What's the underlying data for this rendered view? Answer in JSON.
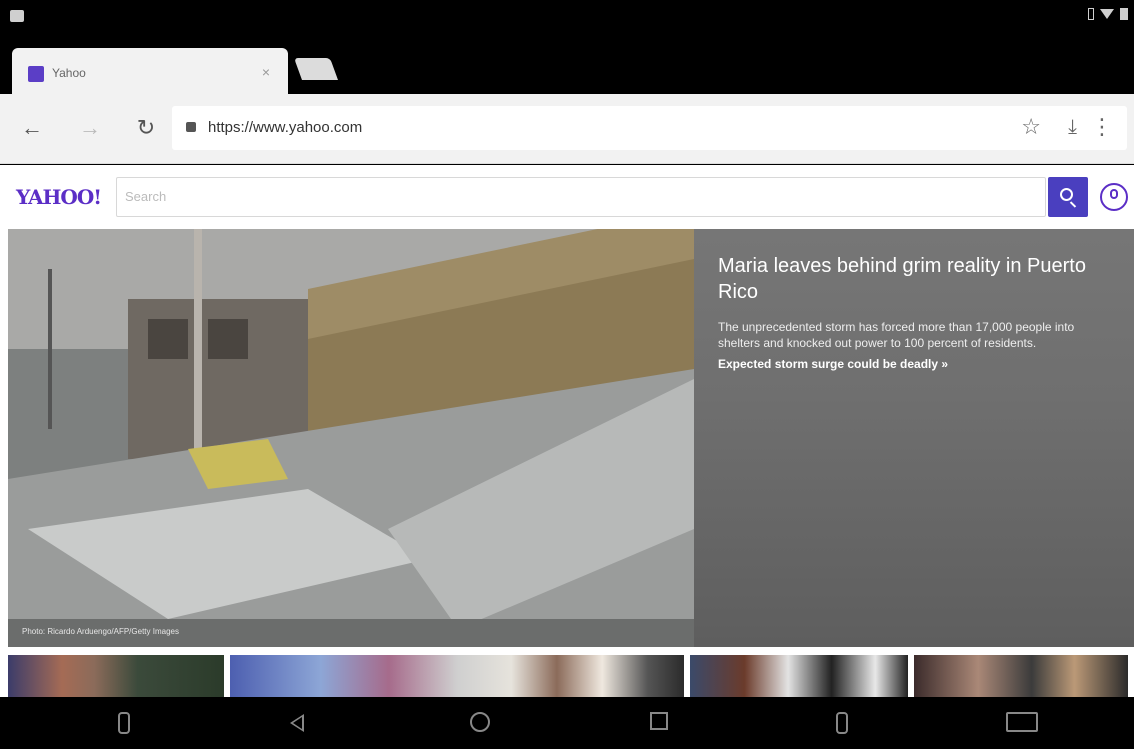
{
  "browser": {
    "tab_title": "Yahoo",
    "tab_close": "×",
    "url": "https://www.yahoo.com",
    "back_icon": "back-arrow-icon",
    "forward_icon": "forward-arrow-icon",
    "reload_icon": "reload-icon",
    "star_icon": "star-icon",
    "download_icon": "download-icon",
    "menu_icon": "overflow-menu-icon"
  },
  "yahoo": {
    "logo": "YAHOO!",
    "search_placeholder": "Search",
    "brand_color": "#5b2ec6",
    "search_button_color": "#4a3fbf"
  },
  "hero": {
    "title": "Maria leaves behind grim reality in Puerto Rico",
    "description": "The unprecedented storm has forced more than 17,000 people into shelters and knocked out power to 100 percent of residents.",
    "link": "Expected storm surge could be deadly »",
    "credit": "Photo: Ricardo Arduengo/AFP/Getty Images"
  },
  "thumbnails": [
    {
      "name": "thumb-1"
    },
    {
      "name": "thumb-2"
    },
    {
      "name": "thumb-3"
    },
    {
      "name": "thumb-4"
    }
  ]
}
